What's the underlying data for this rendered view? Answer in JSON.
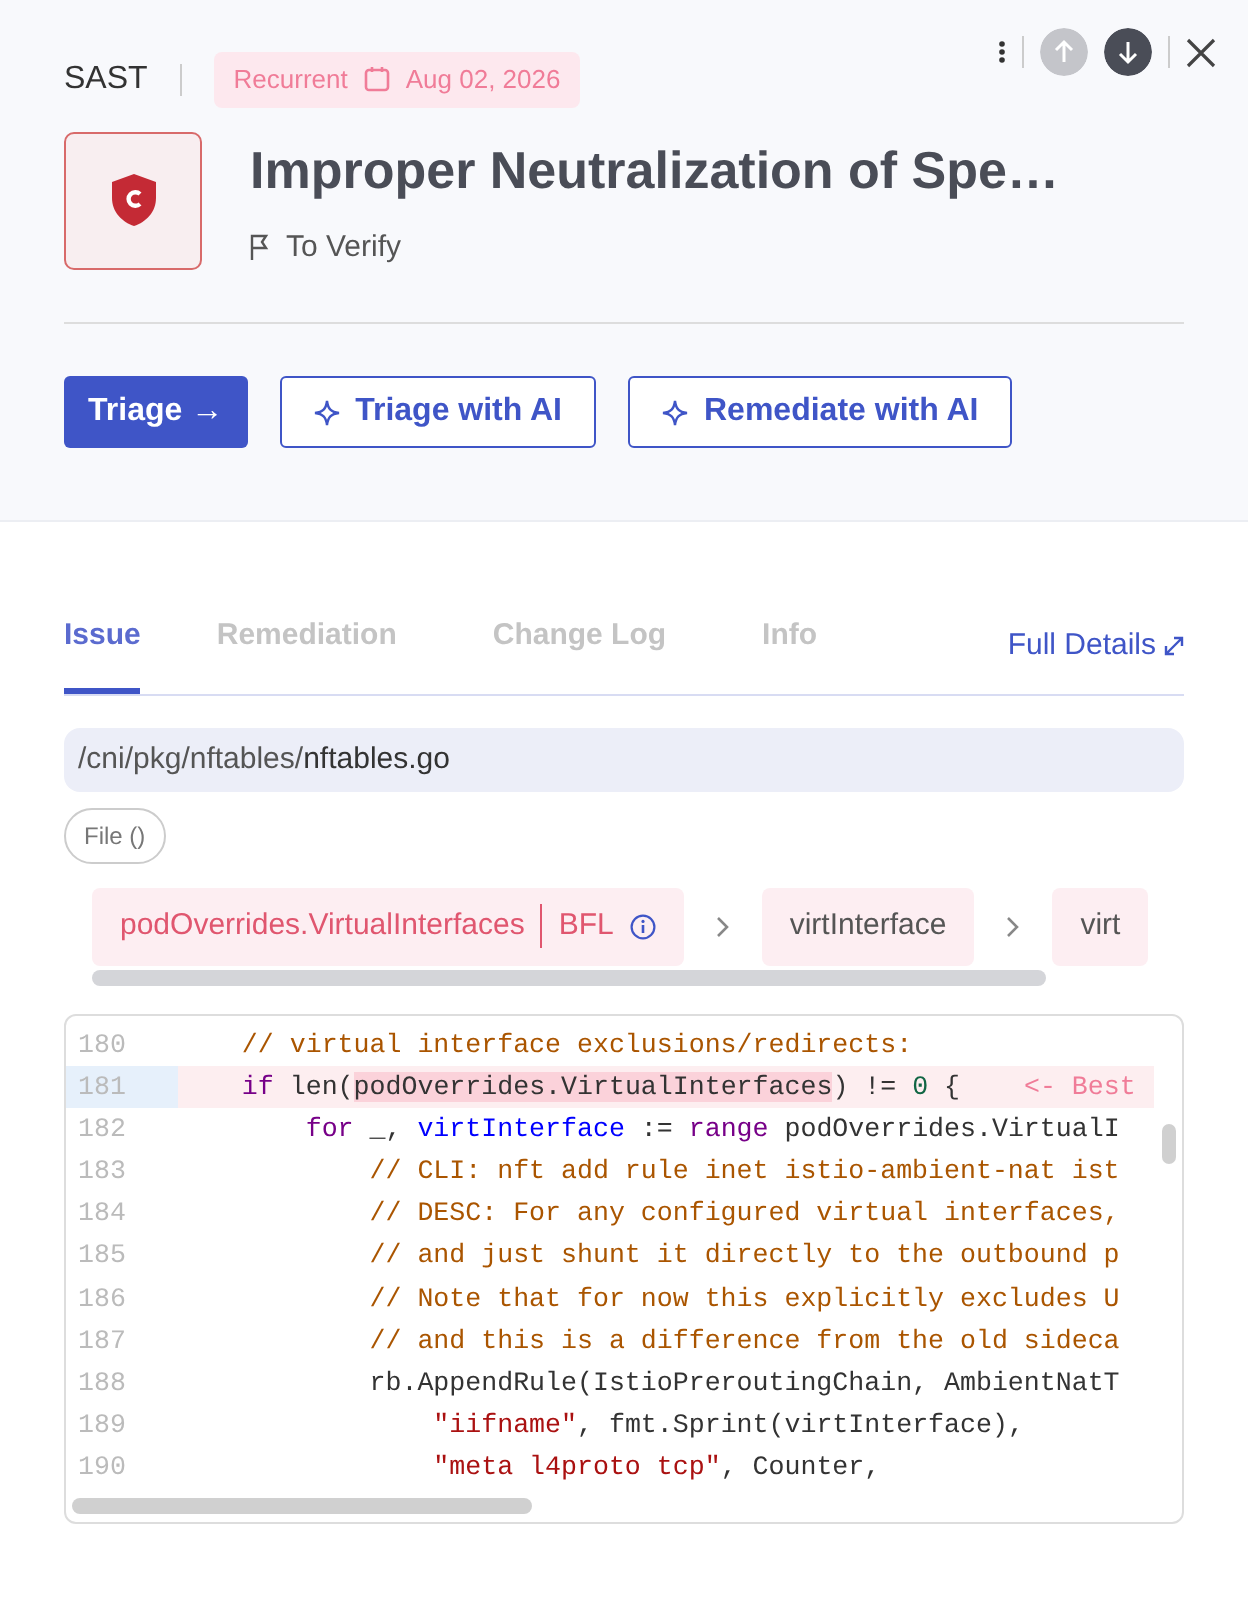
{
  "header": {
    "category": "SAST",
    "tag": {
      "label": "Recurrent",
      "date": "Aug 02, 2026"
    },
    "title": "Improper Neutralization of Spe…",
    "status": "To Verify"
  },
  "actions": [
    {
      "kind": "primary",
      "label": "Triage →"
    },
    {
      "kind": "ai",
      "label": "Triage with AI"
    },
    {
      "kind": "ai",
      "label": "Remediate with AI"
    }
  ],
  "tabs": [
    {
      "label": "Issue",
      "selected": true
    },
    {
      "label": "Remediation",
      "selected": false
    },
    {
      "label": "Change Log",
      "selected": false
    },
    {
      "label": "Info",
      "selected": false
    }
  ],
  "full_details": "Full Details",
  "file_path": {
    "dir": "/cni/pkg/nftables/",
    "file": "nftables.go"
  },
  "file_chip": "File ()",
  "flow": [
    {
      "label": "podOverrides.VirtualInterfaces",
      "tag": "BFL"
    },
    {
      "label": "virtInterface"
    },
    {
      "label": "virt"
    }
  ],
  "code": [
    {
      "number": "180",
      "selected": false,
      "tokens": [
        {
          "kind": "comment",
          "text": "    // virtual interface exclusions/redirects:"
        }
      ]
    },
    {
      "number": "181",
      "selected": true,
      "tokens": [
        {
          "kind": "keyword",
          "text": "    if"
        },
        {
          "kind": "plain",
          "text": " len("
        },
        {
          "kind": "match",
          "text": "podOverrides.VirtualInterfaces"
        },
        {
          "kind": "plain",
          "text": ") != "
        },
        {
          "kind": "number",
          "text": "0"
        },
        {
          "kind": "plain",
          "text": " {    "
        },
        {
          "kind": "marker",
          "text": "<- Best"
        }
      ]
    },
    {
      "number": "182",
      "selected": false,
      "tokens": [
        {
          "kind": "keyword",
          "text": "        for"
        },
        {
          "kind": "plain",
          "text": " _, "
        },
        {
          "kind": "variable",
          "text": "virtInterface"
        },
        {
          "kind": "plain",
          "text": " := "
        },
        {
          "kind": "keyword",
          "text": "range"
        },
        {
          "kind": "plain",
          "text": " podOverrides.VirtualI"
        }
      ]
    },
    {
      "number": "183",
      "selected": false,
      "tokens": [
        {
          "kind": "comment",
          "text": "            // CLI: nft add rule inet istio-ambient-nat ist"
        }
      ]
    },
    {
      "number": "184",
      "selected": false,
      "tokens": [
        {
          "kind": "comment",
          "text": "            // DESC: For any configured virtual interfaces,"
        }
      ]
    },
    {
      "number": "185",
      "selected": false,
      "tokens": [
        {
          "kind": "comment",
          "text": "            // and just shunt it directly to the outbound p"
        }
      ]
    },
    {
      "number": "186",
      "selected": false,
      "tokens": [
        {
          "kind": "comment",
          "text": "            // Note that for now this explicitly excludes U"
        }
      ]
    },
    {
      "number": "187",
      "selected": false,
      "tokens": [
        {
          "kind": "comment",
          "text": "            // and this is a difference from the old sideca"
        }
      ]
    },
    {
      "number": "188",
      "selected": false,
      "tokens": [
        {
          "kind": "plain",
          "text": "            rb.AppendRule(IstioPreroutingChain, AmbientNatT"
        }
      ]
    },
    {
      "number": "189",
      "selected": false,
      "tokens": [
        {
          "kind": "string",
          "text": "                \"iifname\""
        },
        {
          "kind": "plain",
          "text": ", fmt.Sprint(virtInterface),"
        }
      ]
    },
    {
      "number": "190",
      "selected": false,
      "tokens": [
        {
          "kind": "string",
          "text": "                \"meta l4proto tcp\""
        },
        {
          "kind": "plain",
          "text": ", Counter,"
        }
      ]
    }
  ]
}
